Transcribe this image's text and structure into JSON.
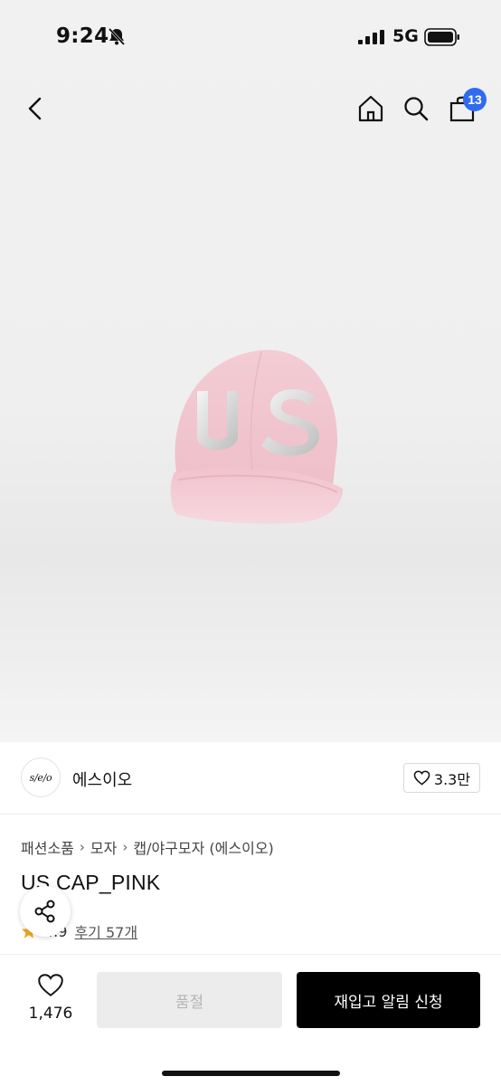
{
  "status_bar": {
    "time": "9:24",
    "network": "5G"
  },
  "header": {
    "cart_count": "13"
  },
  "brand": {
    "logo_text": "s/e/o",
    "name": "에스이오",
    "likes": "3.3만"
  },
  "breadcrumb": [
    "패션소품",
    "모자",
    "캡/야구모자 (에스이오)"
  ],
  "product": {
    "title": "US CAP_PINK",
    "rating": "4.9",
    "reviews": "후기 57개"
  },
  "bottom_bar": {
    "wish_count": "1,476",
    "soldout_label": "품절",
    "restock_label": "재입고 알림 신청"
  },
  "colors": {
    "badge": "#2f6bf0",
    "star": "#f5a623",
    "cap": "#f3c9d2"
  },
  "icons": [
    "bell-off-icon",
    "signal-icon",
    "battery-icon",
    "back-icon",
    "home-icon",
    "search-icon",
    "cart-icon",
    "heart-icon",
    "share-icon",
    "star-icon"
  ]
}
